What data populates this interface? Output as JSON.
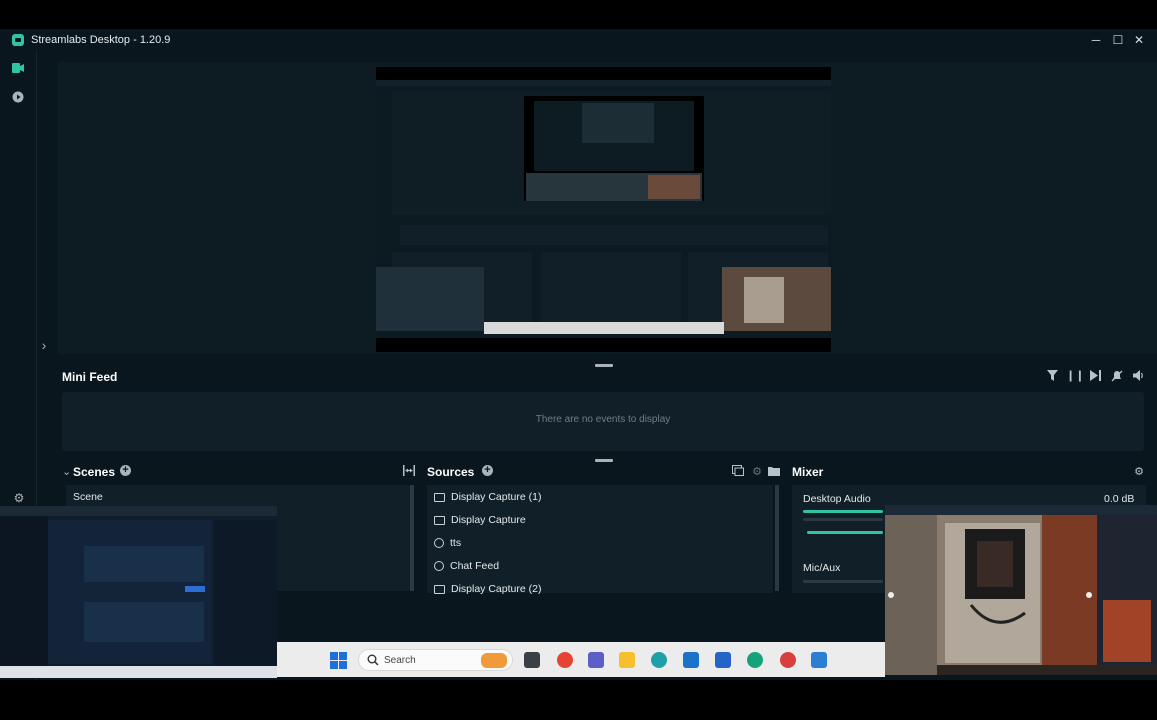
{
  "window": {
    "title": "Streamlabs Desktop - 1.20.9",
    "minimize": "─",
    "maximize": "☐",
    "close": "✕"
  },
  "nav": {
    "studio_icon": "video-camera-icon",
    "play_icon": "play-icon",
    "expand_icon": "›",
    "settings_icon": "gear-icon"
  },
  "minifeed": {
    "title": "Mini Feed",
    "empty_text": "There are no events to display",
    "toolbar": [
      "filter-icon",
      "pause-icon",
      "skip-icon",
      "mute-notifications-icon",
      "volume-icon"
    ]
  },
  "scenes": {
    "title": "Scenes",
    "collapse_glyph": "⌄",
    "add_glyph": "+",
    "items": [
      "Scene"
    ]
  },
  "sources": {
    "title": "Sources",
    "add_glyph": "+",
    "items": [
      {
        "label": "Display Capture (1)",
        "icon": "monitor-icon"
      },
      {
        "label": "Display Capture",
        "icon": "monitor-icon"
      },
      {
        "label": "tts",
        "icon": "globe-icon"
      },
      {
        "label": "Chat Feed",
        "icon": "globe-icon"
      },
      {
        "label": "Display Capture (2)",
        "icon": "monitor-icon"
      }
    ]
  },
  "mixer": {
    "title": "Mixer",
    "channels": [
      {
        "name": "Desktop Audio",
        "level": "0.0 dB"
      },
      {
        "name": "Mic/Aux",
        "level": ""
      }
    ]
  },
  "taskbar": {
    "search_placeholder": "Search"
  },
  "colors": {
    "app_bg": "#09161d",
    "panel_bg": "#112028",
    "accent": "#31c3a2",
    "text_muted": "#6f7d83"
  }
}
